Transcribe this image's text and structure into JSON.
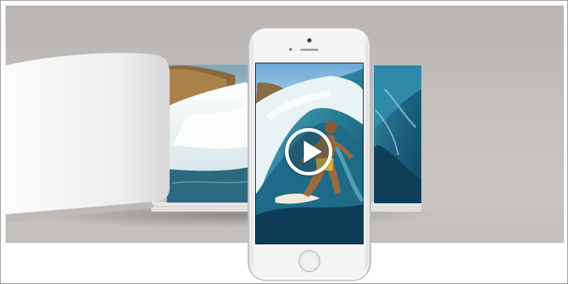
{
  "hero": {
    "image": "photo-book-with-smartphone-surf-video",
    "background": "#c0bdba"
  },
  "video": {
    "state": "paused",
    "play_icon": "play-icon",
    "accent": "#ffffff"
  },
  "phone": {
    "model": "white-smartphone",
    "home_button_icon": "home-button-icon"
  }
}
